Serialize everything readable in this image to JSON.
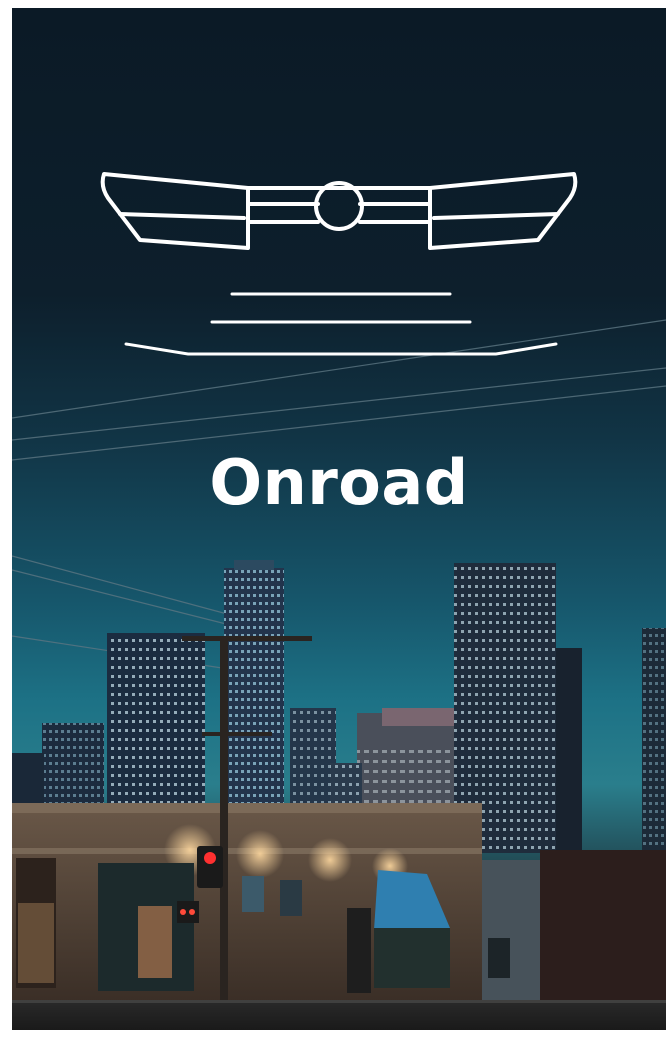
{
  "poster": {
    "title": "Onroad",
    "colors": {
      "sky_top": "#0b1a26",
      "sky_horizon": "#1d7286",
      "title_text": "#ffffff",
      "logo_stroke": "#ffffff"
    },
    "icons": {
      "logo": "winged-grille-emblem-icon"
    }
  }
}
